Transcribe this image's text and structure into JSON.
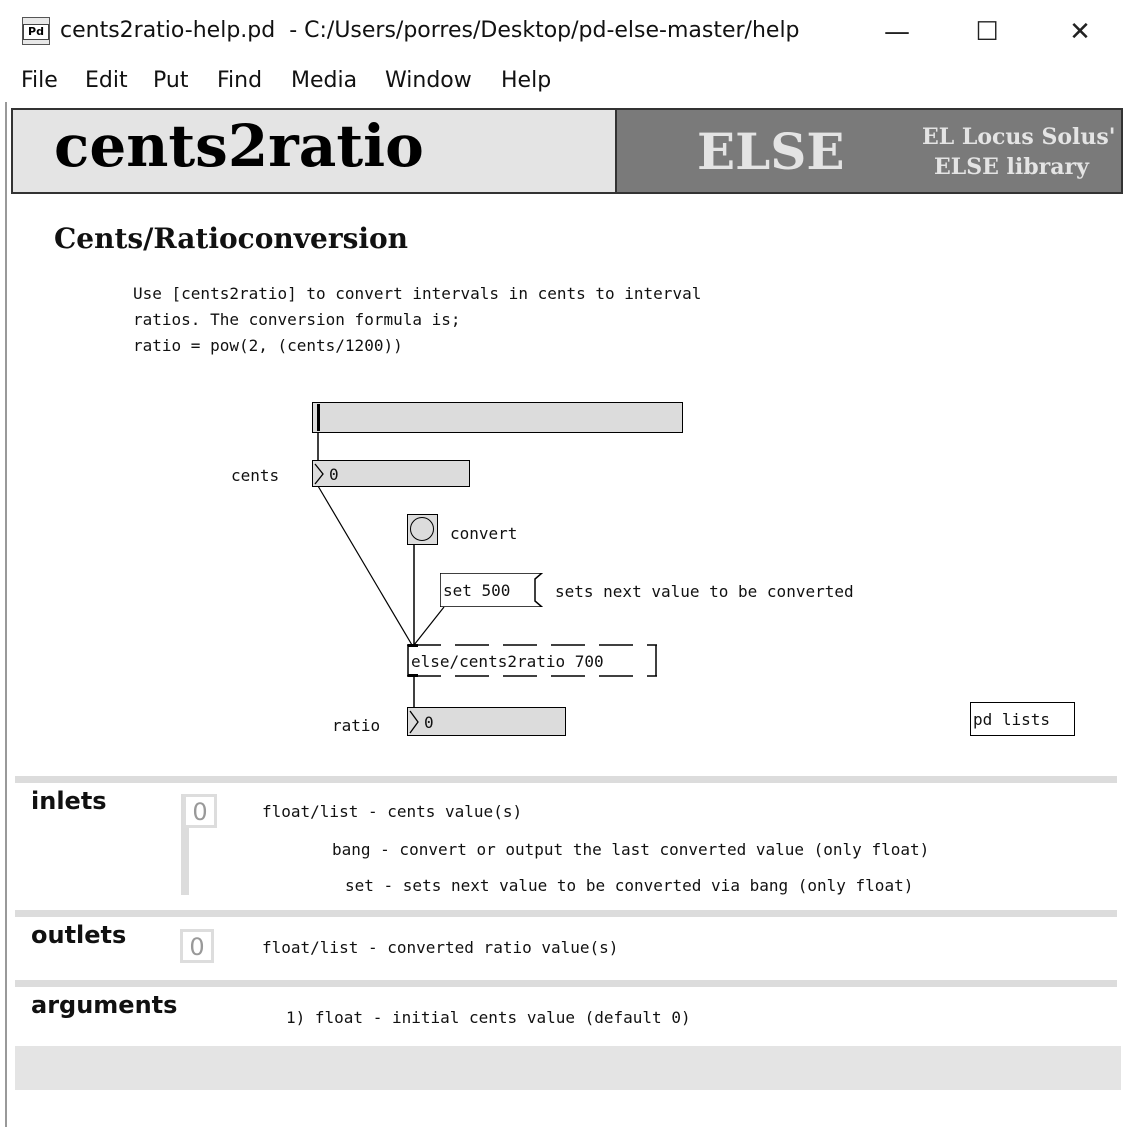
{
  "window": {
    "title": "cents2ratio-help.pd  - C:/Users/porres/Desktop/pd-else-master/help",
    "icon_label": "Pd",
    "minimize": "—",
    "maximize": "☐",
    "close": "✕"
  },
  "menu": [
    "File",
    "Edit",
    "Put",
    "Find",
    "Media",
    "Window",
    "Help"
  ],
  "header": {
    "object_name": "cents2ratio",
    "library_logo": "ELSE",
    "library_line1": "EL Locus Solus'",
    "library_line2": "ELSE  library"
  },
  "subtitle": "Cents/Ratioconversion",
  "description": [
    "Use [cents2ratio] to convert intervals in cents to interval",
    "ratios. The conversion formula is;",
    "ratio = pow(2, (cents/1200))"
  ],
  "patch": {
    "cents_label": "cents",
    "cents_value": "0",
    "convert_label": "convert",
    "set_message": "set 500",
    "set_comment": "sets next value to be converted",
    "object_text": "else/cents2ratio 700",
    "ratio_label": "ratio",
    "ratio_value": "0",
    "subpatch": "pd lists",
    "slider_value": 0
  },
  "inlets": {
    "title": "inlets",
    "port": "0",
    "rows": [
      "float/list - cents value(s)",
      "bang - convert or output the last converted value (only float)",
      "set - sets next value to be converted via bang (only float)"
    ]
  },
  "outlets": {
    "title": "outlets",
    "port": "0",
    "rows": [
      "float/list - converted ratio value(s)"
    ]
  },
  "arguments": {
    "title": "arguments",
    "rows": [
      "1) float - initial cents value (default 0)"
    ]
  },
  "colors": {
    "header_light": "#e4e4e4",
    "header_dark": "#7a7a7a",
    "numbox": "#dcdcdc"
  }
}
